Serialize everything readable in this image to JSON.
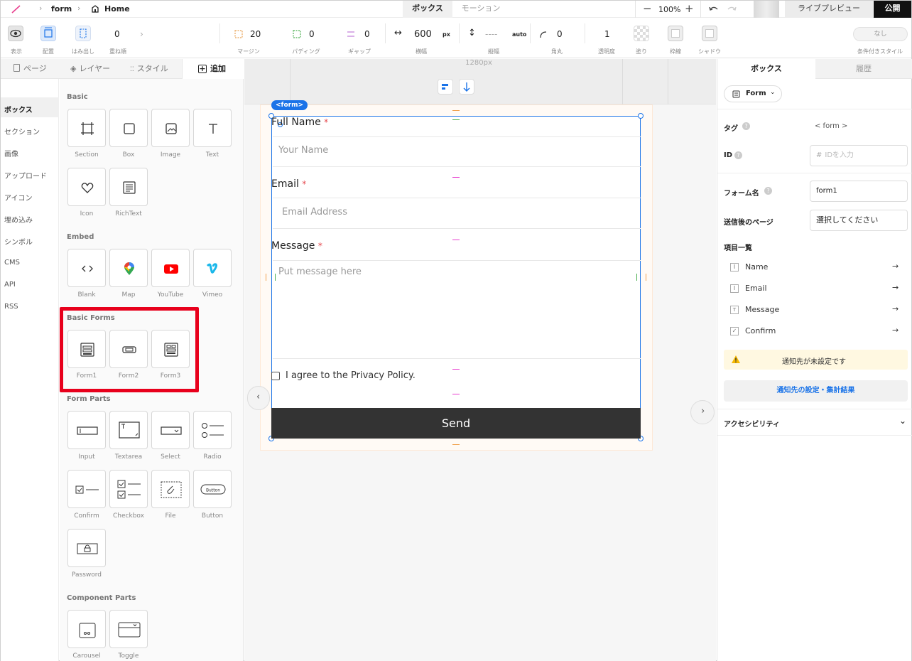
{
  "topbar": {
    "crumb_form": "form",
    "crumb_home": "Home",
    "tab_box": "ボックス",
    "tab_motion": "モーション",
    "zoom": "100%",
    "live_preview": "ライブプレビュー",
    "publish": "公開"
  },
  "toolbar": {
    "view_label": "表示",
    "layout_label": "配置",
    "overflow_label": "はみ出し",
    "order_value": "0",
    "order_label": "重ね順",
    "margin_value": "20",
    "margin_label": "マージン",
    "padding_value": "0",
    "padding_label": "パディング",
    "gap_value": "0",
    "gap_label": "ギャップ",
    "width_value": "600",
    "width_unit": "px",
    "width_label": "横幅",
    "height_value": "----",
    "height_unit": "auto",
    "height_label": "縦幅",
    "radius_value": "0",
    "radius_label": "角丸",
    "opacity_value": "1",
    "opacity_label": "透明度",
    "fill_label": "塗り",
    "border_label": "枠線",
    "shadow_label": "シャドウ",
    "condition_button": "なし",
    "condition_label": "条件付きスタイル"
  },
  "left_tabs": [
    "ページ",
    "レイヤー",
    "スタイル",
    "追加"
  ],
  "categories": [
    "ボックス",
    "セクション",
    "画像",
    "アップロード",
    "アイコン",
    "埋め込み",
    "シンボル",
    "CMS",
    "API",
    "RSS"
  ],
  "sections": {
    "basic": {
      "title": "Basic",
      "items": [
        "Section",
        "Box",
        "Image",
        "Text",
        "Icon",
        "RichText"
      ]
    },
    "embed": {
      "title": "Embed",
      "items": [
        "Blank",
        "Map",
        "YouTube",
        "Vimeo"
      ]
    },
    "basic_forms": {
      "title": "Basic Forms",
      "items": [
        "Form1",
        "Form2",
        "Form3"
      ]
    },
    "form_parts": {
      "title": "Form Parts",
      "items": [
        "Input",
        "Textarea",
        "Select",
        "Radio",
        "Confirm",
        "Checkbox",
        "File",
        "Button",
        "Password"
      ]
    },
    "component_parts": {
      "title": "Component Parts",
      "items": [
        "Carousel",
        "Toggle"
      ]
    }
  },
  "canvas": {
    "ruler_label": "1280px",
    "form_tag": "<form>",
    "full_name_label": "Full Name",
    "full_name_placeholder": "Your Name",
    "email_label": "Email",
    "email_placeholder": "Email Address",
    "message_label": "Message",
    "message_placeholder": "Put message here",
    "required_mark": "*",
    "agree_text": "I agree to the Privacy Policy.",
    "send_label": "Send"
  },
  "right": {
    "tab_box": "ボックス",
    "tab_history": "履歴",
    "element_select": "Form",
    "tag_label": "タグ",
    "tag_value": "< form >",
    "id_label": "ID",
    "id_placeholder": "IDを入力",
    "form_name_label": "フォーム名",
    "form_name_value": "form1",
    "after_page_label": "送信後のページ",
    "after_page_value": "選択してください",
    "items_label": "項目一覧",
    "items": [
      "Name",
      "Email",
      "Message",
      "Confirm"
    ],
    "warning": "通知先が未設定です",
    "notify_button": "通知先の設定・集計結果",
    "accessibility": "アクセシビリティ"
  },
  "colors": {
    "accent": "#1a73e8",
    "highlight": "#e8001c",
    "send_bg": "#333333",
    "required": "#e5484d"
  }
}
